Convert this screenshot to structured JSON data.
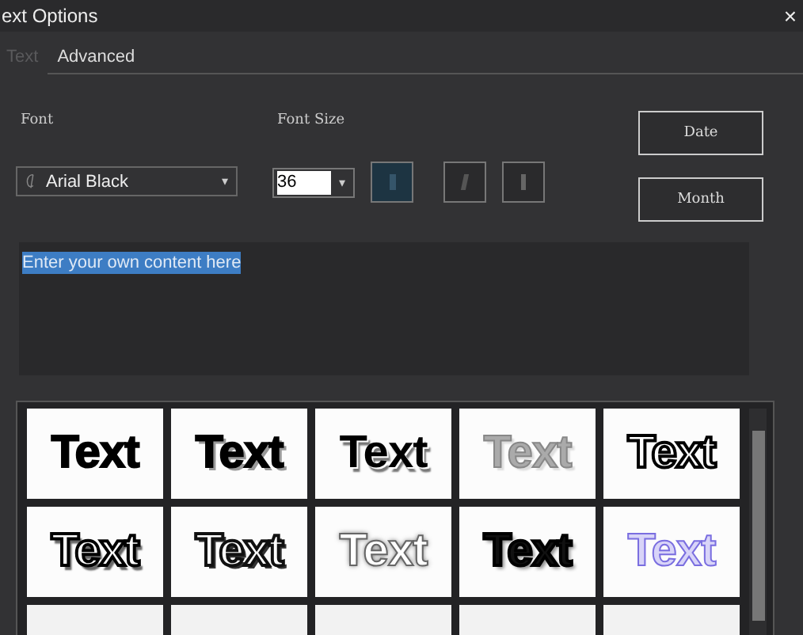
{
  "window": {
    "title": "ext Options",
    "close": "×"
  },
  "tabs": [
    {
      "label": "Text",
      "selected": true
    },
    {
      "label": "Advanced",
      "selected": false
    }
  ],
  "font": {
    "label": "Font",
    "value": "Arial Black",
    "arrow": "▾"
  },
  "font_size": {
    "label": "Font Size",
    "value": "36",
    "arrow": "▾"
  },
  "style_buttons": [
    {
      "kind": "bold",
      "selected": true
    },
    {
      "kind": "italic",
      "selected": false
    },
    {
      "kind": "underline",
      "selected": false
    }
  ],
  "buttons": [
    "Date",
    "Month"
  ],
  "content": {
    "value": "Enter your own content here"
  },
  "presets": [
    {
      "text": "Text",
      "kind": "plain"
    },
    {
      "text": "Text",
      "kind": "shadow"
    },
    {
      "text": "Text",
      "kind": "soft"
    },
    {
      "text": "Text",
      "kind": "metal"
    },
    {
      "text": "Text",
      "kind": "outline"
    },
    {
      "text": "Text",
      "kind": "outline-shadow"
    },
    {
      "text": "Text",
      "kind": "outline-dark"
    },
    {
      "text": "Text",
      "kind": "glow"
    },
    {
      "text": "Text",
      "kind": "stroke"
    },
    {
      "text": "Text",
      "kind": "lavender"
    }
  ]
}
